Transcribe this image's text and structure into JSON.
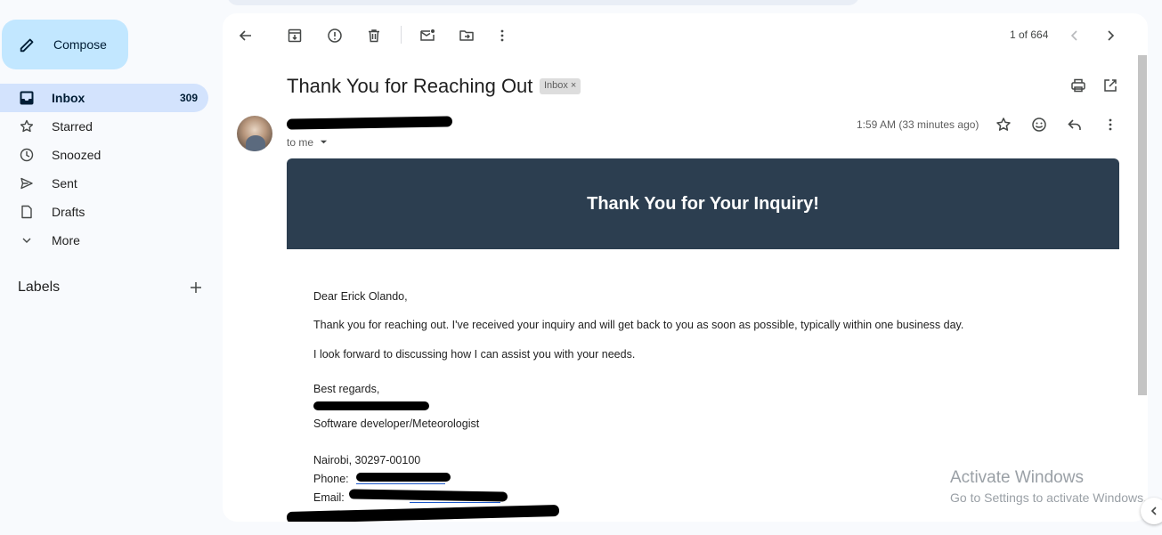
{
  "compose": {
    "label": "Compose"
  },
  "nav": {
    "inbox": {
      "label": "Inbox",
      "count": "309"
    },
    "starred": {
      "label": "Starred"
    },
    "snoozed": {
      "label": "Snoozed"
    },
    "sent": {
      "label": "Sent"
    },
    "drafts": {
      "label": "Drafts"
    },
    "more": {
      "label": "More"
    }
  },
  "labels": {
    "title": "Labels"
  },
  "toolbar": {
    "pager": "1 of 664"
  },
  "email": {
    "subject": "Thank You for Reaching Out",
    "badge": "Inbox",
    "badge_close": "×",
    "recipient": "to me",
    "timestamp": "1:59 AM (33 minutes ago)",
    "banner": "Thank You for Your Inquiry!",
    "greeting": "Dear Erick Olando,",
    "para1": "Thank you for reaching out. I've received your inquiry and will get back to you as soon as possible, typically within one business day.",
    "para2": "I look forward to discussing how I can assist you with your needs.",
    "closing": "Best regards,",
    "role": "Software developer/Meteorologist",
    "address": "Nairobi, 30297-00100",
    "phone_label": "Phone:",
    "email_label": "Email:"
  },
  "watermark": {
    "line1": "Activate Windows",
    "line2": "Go to Settings to activate Windows."
  },
  "colors": {
    "accent": "#c2e7ff",
    "active_nav": "#d3e3fd",
    "banner": "#2c3e50"
  }
}
